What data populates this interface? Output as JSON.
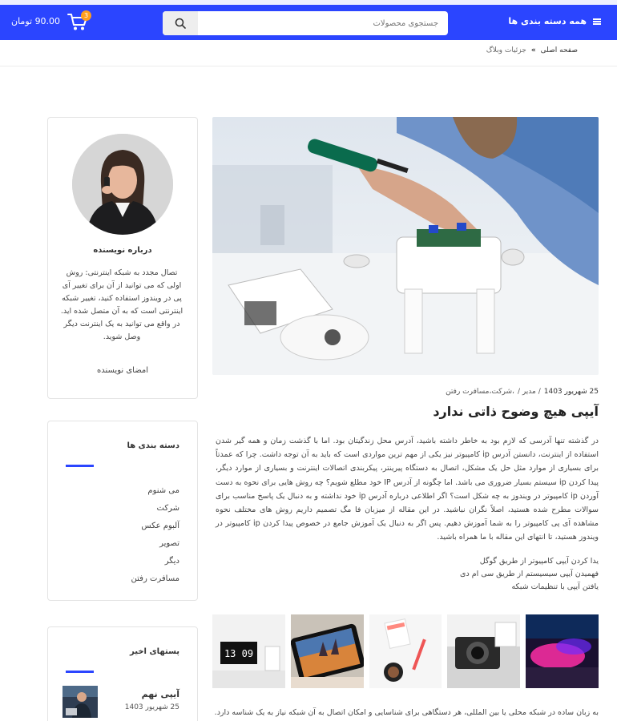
{
  "header": {
    "categories_label": "همه دسته بندی ها",
    "search_placeholder": "جستجوی محصولات",
    "cart_count": "3",
    "cart_total": "90.00 تومان"
  },
  "breadcrumb": {
    "home": "صفحه اصلی",
    "separator": "»",
    "current": "جزئیات وبلاگ"
  },
  "author": {
    "heading": "درباره نویسنده",
    "bio": "تصال مجدد به شبکه اینترنتی: روش اولی که می توانید از آن برای تغییر آی پی در ویندوز استفاده کنید، تغییر شبکه اینترنتی است که به آن متصل شده اید. در واقع می توانید به یک اینترنت دیگر وصل شوید.",
    "signature": "امضای نویسنده"
  },
  "categories": {
    "heading": "دسته بندی ها",
    "items": [
      "می شنوم",
      "شرکت",
      "آلبوم عکس",
      "تصویر",
      "دیگر",
      "مسافرت رفتن"
    ]
  },
  "recent": {
    "heading": "پستهای اخیر",
    "items": [
      {
        "title": "آیپی نهم",
        "date": "25 شهریور 1403"
      }
    ]
  },
  "post": {
    "meta_date": "25 شهریور 1403",
    "meta_author": "/ مدیر /",
    "meta_category": "،شرکت،مسافرت رفتن",
    "title": "آیپی هیچ وضوح ذاتی ندارد",
    "body": "در گذشته تنها آدرسی که لازم بود به خاطر داشته باشید، آدرس محل زندگیتان بود. اما با گذشت زمان و همه گیر شدن استفاده از اینترنت، دانستن آدرس ip کامپیوتر نیز یکی از مهم ترین مواردی است که باید به آن توجه داشت. چرا که عمدتاً برای بسیاری از موارد مثل حل یک مشکل، اتصال به دستگاه پیرینتر، پیکربندی اتصالات اینترنت و بسیاری از موارد دیگر، پیدا کردن ip سیستم بسیار ضروری می باشد. اما چگونه از آدرس IP خود مطلع شویم؟ چه روش هایی برای نحوه به دست آوردن ip کامپیوتر در ویندوز به چه شکل است؟ اگر اطلاعی درباره آدرس ip خود نداشته و به دنبال یک پاسخ مناسب برای سوالات مطرح شده هستید، اصلاً نگران نباشید. در این مقاله از میزبان فا مگ تصمیم داریم روش های مختلف نحوه مشاهده آی پی کامپیوتر را به شما آموزش دهیم. پس اگر به دنبال یک آموزش جامع در خصوص پیدا کردن ip کامپیوتر در ویندوز هستید، تا انتهای این مقاله با ما همراه باشید.",
    "links": [
      "یدا کردن آیپی کامپیوتر از طریق گوگل",
      "فهمیدن آیپی سیسیستم از طریق سی ام دی",
      "یافتن آیپی با تنظیمات شبکه"
    ],
    "clock_text": "13 09",
    "footer_text": "به زبان ساده در شبکه محلی یا بین المللی، هر دستگاهی برای شناسایی و امکان اتصال به آن شبکه نیاز به یک شناسه دارد."
  },
  "colors": {
    "brand": "#2b45ff",
    "badge": "#ff9f1c"
  }
}
